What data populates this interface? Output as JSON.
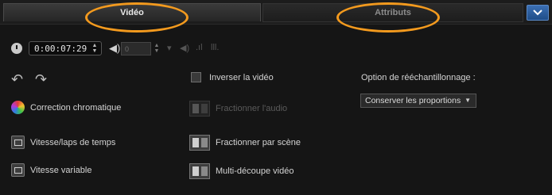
{
  "tabs": [
    {
      "label": "Vidéo",
      "active": true
    },
    {
      "label": "Attributs",
      "active": false
    }
  ],
  "highlight_color": "#f39a1e",
  "accent_color": "#2d62a6",
  "collapse_button_icon": "chevron-down-icon",
  "controls": {
    "timecode": "0:00:07:29",
    "volume_value": "0",
    "clock_icon": "clock-icon",
    "volume_icon": "speaker-icon"
  },
  "rotate": {
    "left_icon": "rotate-left-icon",
    "right_icon": "rotate-right-icon"
  },
  "left_items": [
    {
      "label": "Correction chromatique",
      "icon": "color-wheel-icon"
    },
    {
      "label": "Vitesse/laps de temps",
      "icon": "speed-icon"
    },
    {
      "label": "Vitesse variable",
      "icon": "variable-speed-icon"
    }
  ],
  "middle_items": {
    "reverse_label": "Inverser la vidéo",
    "split_audio_label": "Fractionner l'audio",
    "split_scene_label": "Fractionner par scène",
    "multi_trim_label": "Multi-découpe vidéo"
  },
  "resample": {
    "label": "Option de rééchantillonnage :",
    "selected": "Conserver les proportions"
  }
}
